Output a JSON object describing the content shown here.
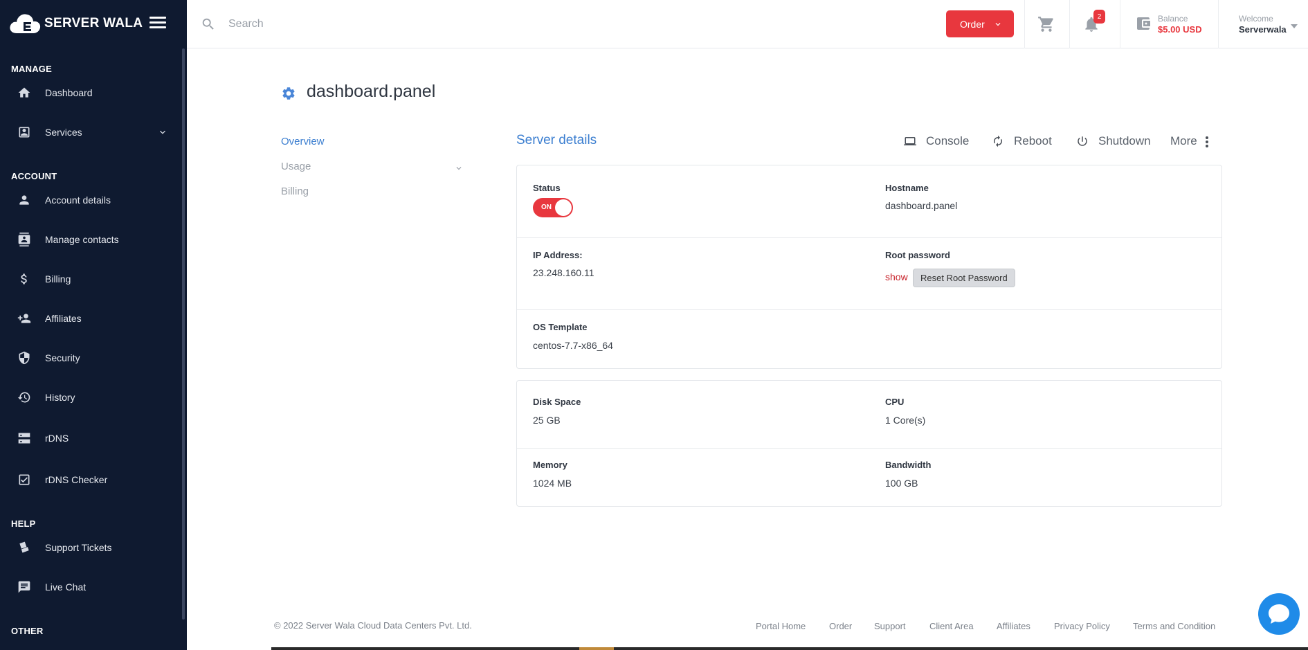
{
  "brand": {
    "name": "SERVER WALA"
  },
  "sidebar": {
    "sections": {
      "manage": "MANAGE",
      "account": "ACCOUNT",
      "help": "HELP",
      "other": "OTHER"
    },
    "items": {
      "dashboard": "Dashboard",
      "services": "Services",
      "account_details": "Account details",
      "manage_contacts": "Manage contacts",
      "billing": "Billing",
      "affiliates": "Affiliates",
      "security": "Security",
      "history": "History",
      "rdns": "rDNS",
      "rdns_checker": "rDNS Checker",
      "support_tickets": "Support Tickets",
      "live_chat": "Live Chat"
    }
  },
  "topbar": {
    "search_placeholder": "Search",
    "order_label": "Order",
    "notification_count": "2",
    "balance_label": "Balance",
    "balance_value": "$5.00 USD",
    "welcome_label": "Welcome",
    "username": "Serverwala"
  },
  "page": {
    "title": "dashboard.panel",
    "subnav": {
      "overview": "Overview",
      "usage": "Usage",
      "billing": "Billing"
    },
    "section_title": "Server details",
    "actions": {
      "console": "Console",
      "reboot": "Reboot",
      "shutdown": "Shutdown",
      "more": "More"
    }
  },
  "details": {
    "status_label": "Status",
    "status_value": "ON",
    "hostname_label": "Hostname",
    "hostname_value": "dashboard.panel",
    "ip_label": "IP Address:",
    "ip_value": "23.248.160.11",
    "root_label": "Root password",
    "root_show": "show",
    "root_reset": "Reset Root Password",
    "os_label": "OS Template",
    "os_value": "centos-7.7-x86_64"
  },
  "resources": {
    "disk_label": "Disk Space",
    "disk_value": "25 GB",
    "cpu_label": "CPU",
    "cpu_value": "1 Core(s)",
    "memory_label": "Memory",
    "memory_value": "1024 MB",
    "bandwidth_label": "Bandwidth",
    "bandwidth_value": "100 GB"
  },
  "footer": {
    "copyright": "© 2022 Server Wala Cloud Data Centers Pvt. Ltd.",
    "links": {
      "portal_home": "Portal Home",
      "order": "Order",
      "support": "Support",
      "client_area": "Client Area",
      "affiliates": "Affiliates",
      "privacy": "Privacy Policy",
      "terms": "Terms and Condition"
    }
  },
  "colors": {
    "sidebar_bg": "#0f1a30",
    "accent_red": "#e8373e",
    "link_blue": "#3b7ed0",
    "chat_blue": "#1f8be8"
  }
}
